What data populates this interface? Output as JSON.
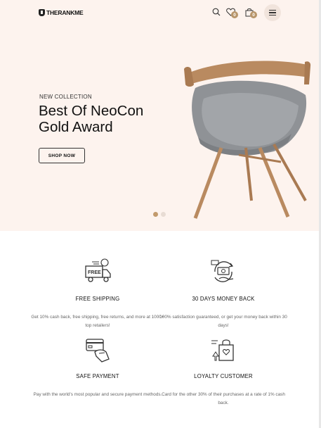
{
  "header": {
    "logo_text": "THERANKME",
    "wishlist_count": "0",
    "cart_count": "0"
  },
  "hero": {
    "eyebrow": "NEW COLLECTION",
    "title_line1": "Best Of NeoCon",
    "title_line2": "Gold Award",
    "cta_label": "SHOP NOW",
    "slides": 2,
    "active_slide": 1
  },
  "features": [
    {
      "title": "FREE SHIPPING",
      "desc": "Get 10% cash back, free shipping, free returns, and more at 1000+ top retailers!",
      "icon": "free-delivery-truck-icon",
      "icon_text": "FREE"
    },
    {
      "title": "30 DAYS MONEY BACK",
      "desc": "100% satisfaction guaranteed, or get your money back within 30 days!",
      "icon": "money-back-icon"
    },
    {
      "title": "SAFE PAYMENT",
      "desc": "Pay with the world's most popular and secure payment methods.",
      "icon": "card-payment-icon"
    },
    {
      "title": "LOYALTY CUSTOMER",
      "desc": "Card for the other 30% of their purchases at a rate of 1% cash back.",
      "icon": "loyalty-bag-icon"
    }
  ],
  "colors": {
    "hero_bg": "#fdf3ee",
    "accent": "#c29a6c",
    "badge": "#b8956a"
  }
}
